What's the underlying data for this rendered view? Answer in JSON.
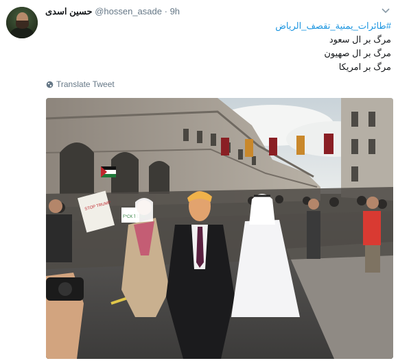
{
  "tweet": {
    "author_name": "حسین اسدی",
    "handle": "@hossen_asade",
    "separator": "·",
    "time": "9h",
    "hashtag": "#طائرات_يمنية_تقصف_الرياض",
    "lines": [
      "مرگ بر ال سعود",
      "مرگ بر ال صهیون",
      "مرگ بر امریکا"
    ],
    "translate_label": "Translate Tweet",
    "photo_alt_subject": "street-protest-photo"
  },
  "photo_signs": {
    "sign_left": "STOP TRUMP",
    "sign_left_sub": "F*CK TEAM"
  },
  "colors": {
    "hashtag": "#1b95e0",
    "secondary_text": "#657786",
    "primary_text": "#14171a"
  },
  "icons": [
    "chevron-down-icon",
    "globe-icon"
  ]
}
